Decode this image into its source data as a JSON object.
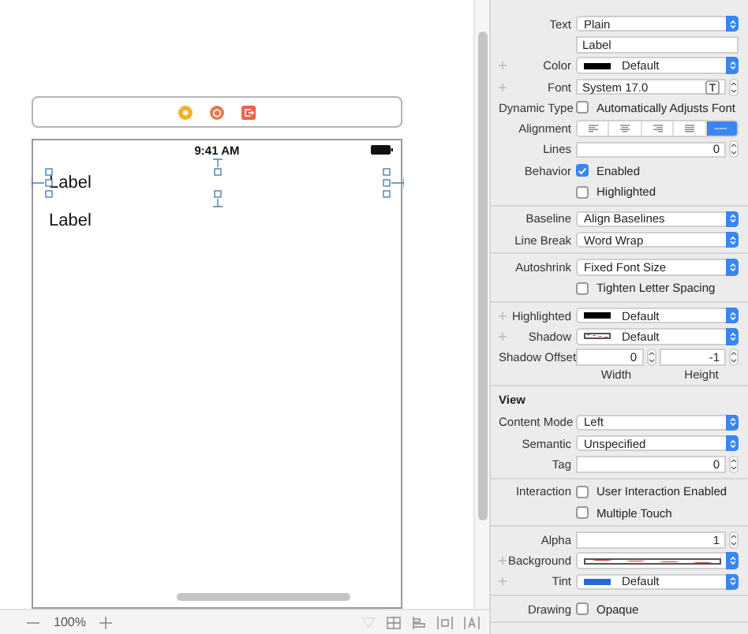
{
  "canvas": {
    "status_time": "9:41 AM",
    "labels": [
      {
        "text": "Label",
        "selected": true
      },
      {
        "text": "Label",
        "selected": false
      }
    ]
  },
  "bottom_bar": {
    "zoom": "100%"
  },
  "inspector": {
    "groups": [
      {
        "rows": [
          {
            "kind": "popup",
            "label": "Text",
            "value": "Plain"
          },
          {
            "kind": "field",
            "value": "Label"
          },
          {
            "kind": "color",
            "label": "Color",
            "color": "#000000",
            "value": "Default",
            "variants": true
          },
          {
            "kind": "font",
            "label": "Font",
            "value": "System 17.0",
            "variants": true
          },
          {
            "kind": "checkbox",
            "label": "Dynamic Type",
            "text": "Automatically Adjusts Font",
            "checked": false
          },
          {
            "kind": "segmented",
            "label": "Alignment",
            "segments": [
              {
                "kind": "left",
                "selected": false
              },
              {
                "kind": "center",
                "selected": false
              },
              {
                "kind": "right",
                "selected": false
              },
              {
                "kind": "justified",
                "selected": false
              },
              {
                "kind": "natural",
                "selected": true
              }
            ]
          },
          {
            "kind": "stepper",
            "label": "Lines",
            "value": "0"
          },
          {
            "kind": "checkbox",
            "label": "Behavior",
            "text": "Enabled",
            "checked": true
          },
          {
            "kind": "checkbox",
            "text": "Highlighted",
            "checked": false
          }
        ]
      },
      {
        "rows": [
          {
            "kind": "popup",
            "label": "Baseline",
            "value": "Align Baselines"
          },
          {
            "kind": "popup",
            "label": "Line Break",
            "value": "Word Wrap"
          }
        ]
      },
      {
        "rows": [
          {
            "kind": "popup",
            "label": "Autoshrink",
            "value": "Fixed Font Size"
          },
          {
            "kind": "checkbox",
            "text": "Tighten Letter Spacing",
            "checked": false
          }
        ]
      },
      {
        "rows": [
          {
            "kind": "color",
            "label": "Highlighted",
            "color": "#000000",
            "value": "Default",
            "variants": true
          },
          {
            "kind": "clear_color",
            "label": "Shadow",
            "value": "Default",
            "variants": true
          },
          {
            "kind": "offset",
            "label": "Shadow Offset",
            "values": [
              {
                "value": "0",
                "caption": "Width"
              },
              {
                "value": "-1",
                "caption": "Height"
              }
            ]
          }
        ]
      },
      {
        "title": "View",
        "rows": [
          {
            "kind": "popup",
            "label": "Content Mode",
            "value": "Left"
          },
          {
            "kind": "popup",
            "label": "Semantic",
            "value": "Unspecified"
          },
          {
            "kind": "stepper",
            "label": "Tag",
            "value": "0"
          }
        ]
      },
      {
        "rows": [
          {
            "kind": "checkbox",
            "label": "Interaction",
            "text": "User Interaction Enabled",
            "checked": false
          },
          {
            "kind": "checkbox",
            "text": "Multiple Touch",
            "checked": false
          }
        ]
      },
      {
        "rows": [
          {
            "kind": "stepper",
            "label": "Alpha",
            "value": "1"
          },
          {
            "kind": "clear_color",
            "label": "Background",
            "variants": true
          },
          {
            "kind": "color",
            "label": "Tint",
            "color": "#1f6fd6",
            "value": "Default",
            "variants": true
          }
        ]
      },
      {
        "rows": [
          {
            "kind": "checkbox",
            "label": "Drawing",
            "text": "Opaque",
            "checked": false
          }
        ]
      }
    ]
  }
}
